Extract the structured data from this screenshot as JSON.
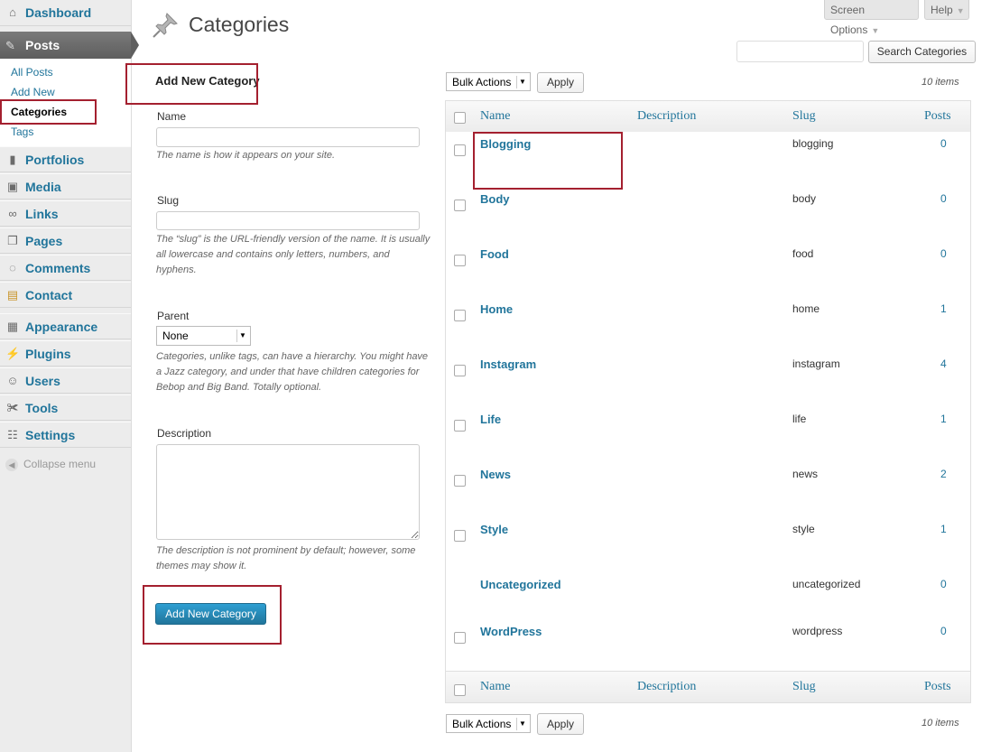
{
  "sidebar": {
    "dashboard": "Dashboard",
    "posts": "Posts",
    "submenu": [
      "All Posts",
      "Add New",
      "Categories",
      "Tags"
    ],
    "items": [
      "Portfolios",
      "Media",
      "Links",
      "Pages",
      "Comments",
      "Contact",
      "Appearance",
      "Plugins",
      "Users",
      "Tools",
      "Settings"
    ],
    "collapse": "Collapse menu"
  },
  "top": {
    "screen_options": "Screen Options",
    "help": "Help"
  },
  "page_title": "Categories",
  "search": {
    "button": "Search Categories",
    "value": ""
  },
  "form": {
    "heading": "Add New Category",
    "name_label": "Name",
    "name_help": "The name is how it appears on your site.",
    "slug_label": "Slug",
    "slug_help": "The “slug” is the URL-friendly version of the name. It is usually all lowercase and contains only letters, numbers, and hyphens.",
    "parent_label": "Parent",
    "parent_value": "None",
    "parent_help": "Categories, unlike tags, can have a hierarchy. You might have a Jazz category, and under that have children categories for Bebop and Big Band. Totally optional.",
    "description_label": "Description",
    "description_help": "The description is not prominent by default; however, some themes may show it.",
    "submit": "Add New Category"
  },
  "table": {
    "bulk_actions": "Bulk Actions",
    "apply": "Apply",
    "count": "10 items",
    "columns": {
      "name": "Name",
      "description": "Description",
      "slug": "Slug",
      "posts": "Posts"
    },
    "rows": [
      {
        "name": "Blogging",
        "slug": "blogging",
        "posts": "0"
      },
      {
        "name": "Body",
        "slug": "body",
        "posts": "0"
      },
      {
        "name": "Food",
        "slug": "food",
        "posts": "0"
      },
      {
        "name": "Home",
        "slug": "home",
        "posts": "1"
      },
      {
        "name": "Instagram",
        "slug": "instagram",
        "posts": "4"
      },
      {
        "name": "Life",
        "slug": "life",
        "posts": "1"
      },
      {
        "name": "News",
        "slug": "news",
        "posts": "2"
      },
      {
        "name": "Style",
        "slug": "style",
        "posts": "1"
      },
      {
        "name": "Uncategorized",
        "slug": "uncategorized",
        "posts": "0"
      },
      {
        "name": "WordPress",
        "slug": "wordpress",
        "posts": "0"
      }
    ]
  },
  "colors": {
    "link": "#21759b",
    "highlight": "#a4202f",
    "primary_button": "#21759b"
  }
}
